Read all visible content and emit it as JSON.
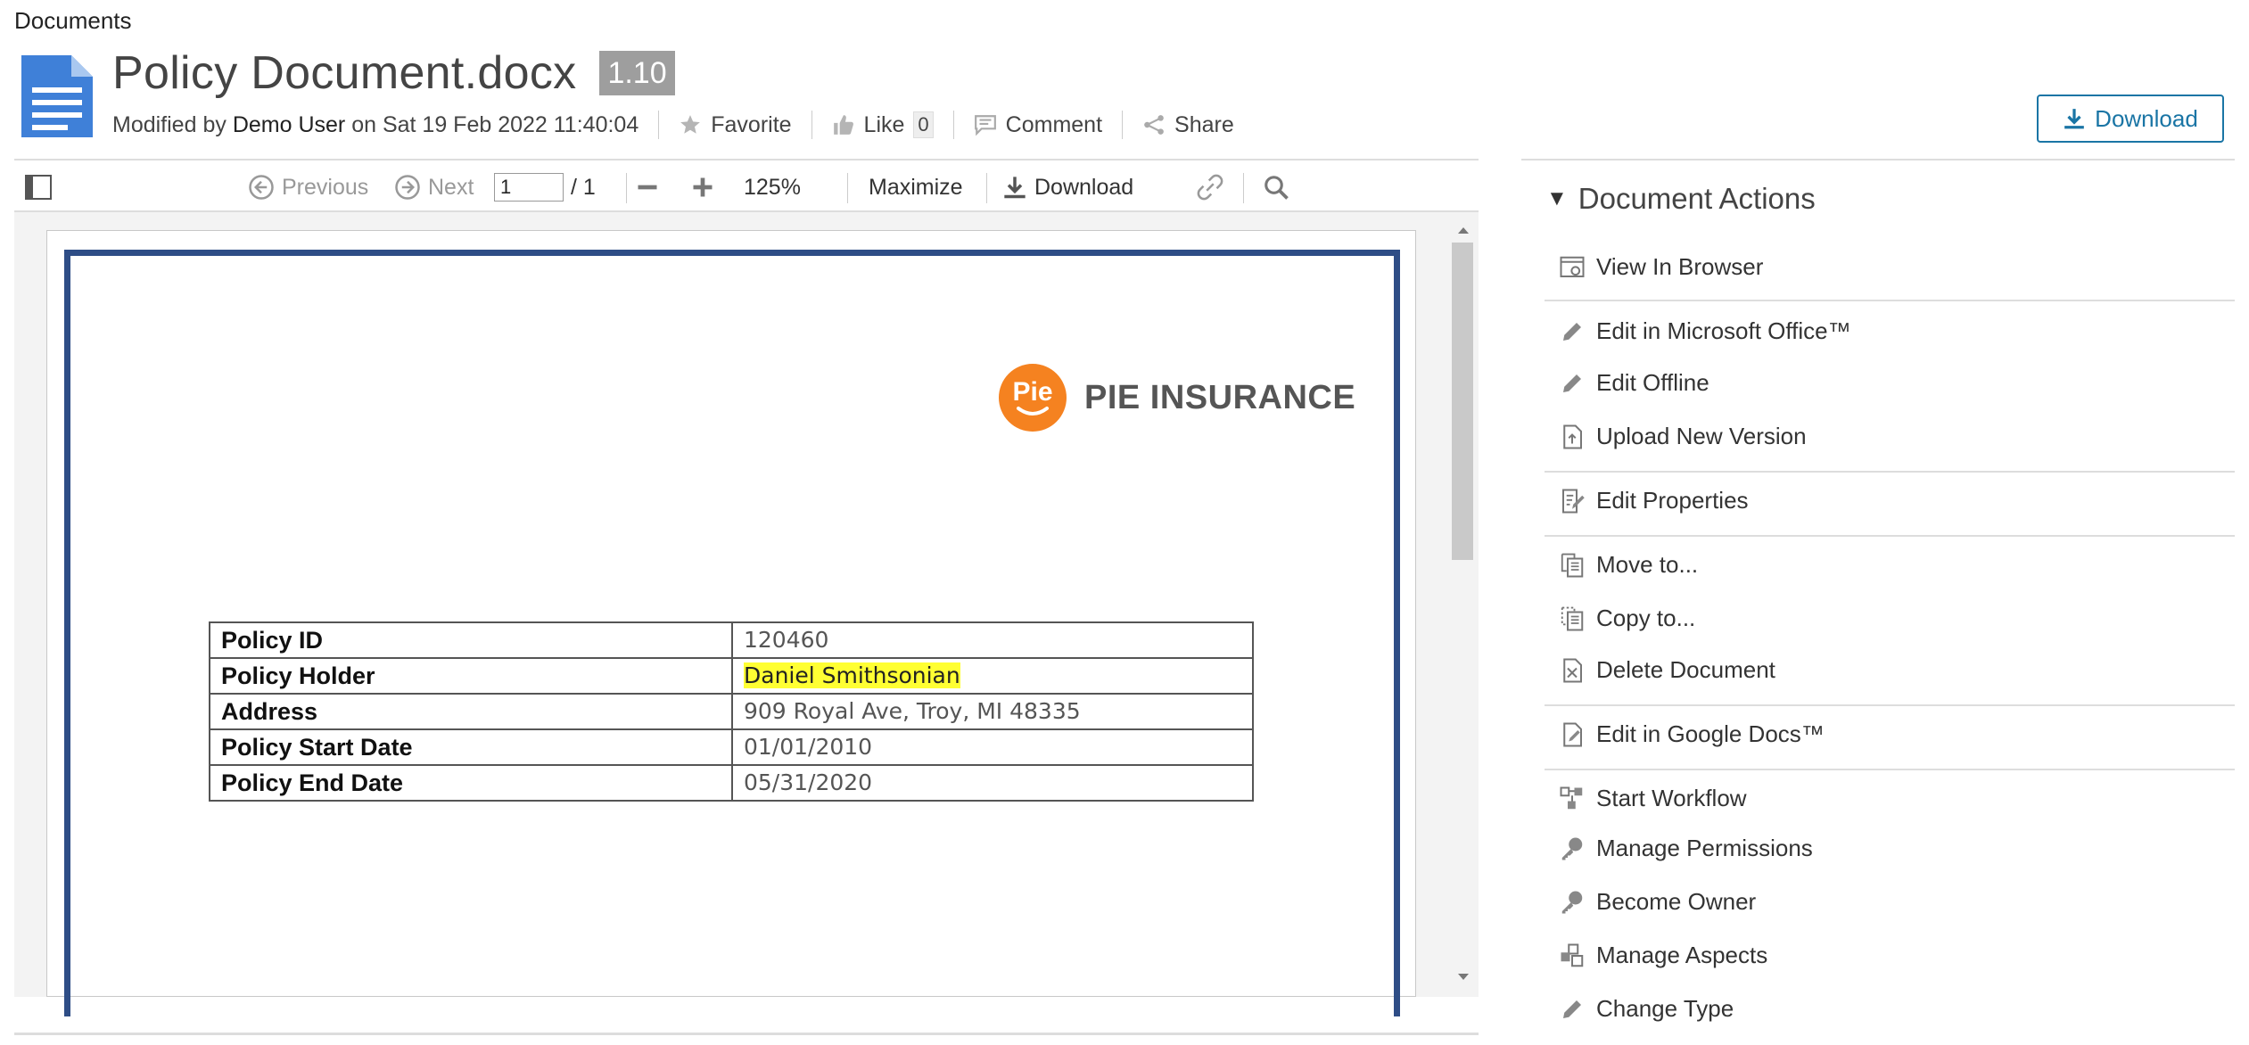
{
  "breadcrumb": "Documents",
  "document": {
    "title": "Policy Document.docx",
    "version": "1.10",
    "meta_prefix": "Modified by",
    "modifier": "Demo User",
    "meta_on": "on",
    "modified_date": "Sat 19 Feb 2022 11:40:04"
  },
  "social": {
    "favorite": "Favorite",
    "like": "Like",
    "like_count": "0",
    "comment": "Comment",
    "share": "Share"
  },
  "header_download": "Download",
  "toolbar": {
    "previous": "Previous",
    "next": "Next",
    "page_value": "1",
    "page_total": "/ 1",
    "zoom": "125%",
    "maximize": "Maximize",
    "download": "Download"
  },
  "preview": {
    "logo_mark": "Pie",
    "logo_text": "PIE INSURANCE",
    "rows": [
      {
        "label": "Policy ID",
        "value": "120460"
      },
      {
        "label": "Policy Holder",
        "value": "Daniel Smithsonian"
      },
      {
        "label": "Address",
        "value": "909 Royal Ave, Troy, MI 48335"
      },
      {
        "label": "Policy Start Date",
        "value": "01/01/2010"
      },
      {
        "label": "Policy End Date",
        "value": "05/31/2020"
      }
    ]
  },
  "actions": {
    "title": "Document Actions",
    "items": [
      {
        "label": "View In Browser",
        "icon": "browser-icon"
      },
      {
        "label": "Edit in Microsoft Office™",
        "icon": "pencil-icon"
      },
      {
        "label": "Edit Offline",
        "icon": "pencil-icon"
      },
      {
        "label": "Upload New Version",
        "icon": "upload-icon"
      },
      {
        "label": "Edit Properties",
        "icon": "properties-icon"
      },
      {
        "label": "Move to...",
        "icon": "move-icon"
      },
      {
        "label": "Copy to...",
        "icon": "copy-icon"
      },
      {
        "label": "Delete Document",
        "icon": "delete-icon"
      },
      {
        "label": "Edit in Google Docs™",
        "icon": "google-docs-icon"
      },
      {
        "label": "Start Workflow",
        "icon": "workflow-icon"
      },
      {
        "label": "Manage Permissions",
        "icon": "key-icon"
      },
      {
        "label": "Become Owner",
        "icon": "key-icon"
      },
      {
        "label": "Manage Aspects",
        "icon": "aspects-icon"
      },
      {
        "label": "Change Type",
        "icon": "pencil-icon"
      }
    ]
  }
}
